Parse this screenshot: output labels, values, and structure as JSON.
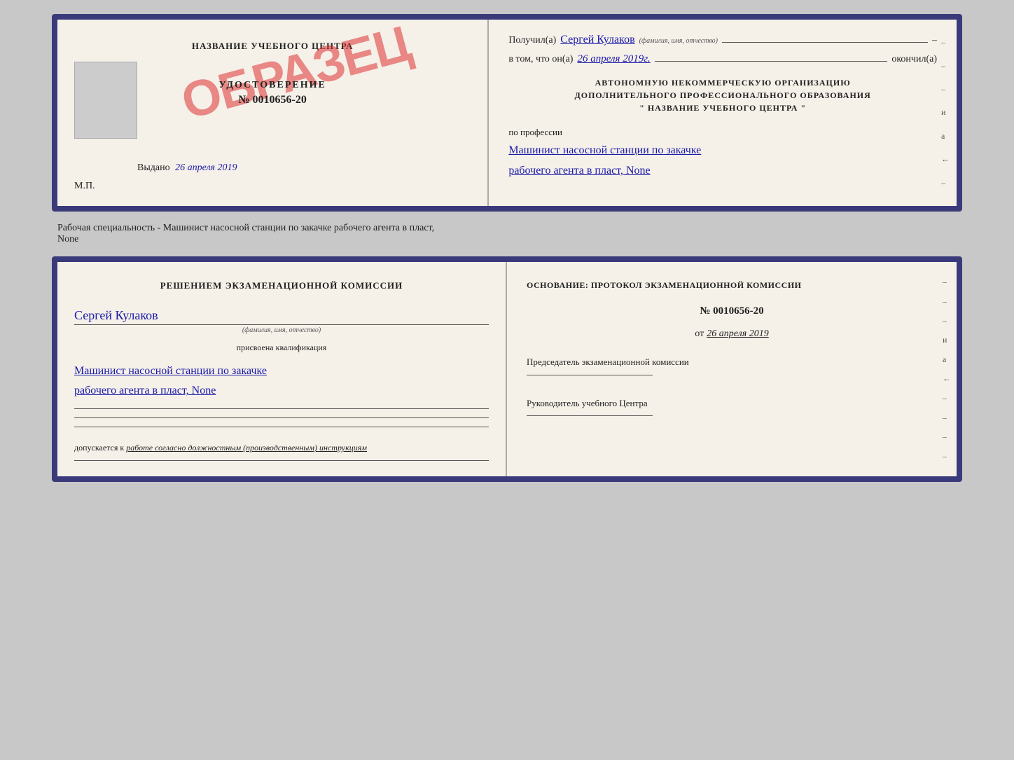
{
  "topDoc": {
    "left": {
      "training_center": "НАЗВАНИЕ УЧЕБНОГО ЦЕНТРА",
      "cert_label": "УДОСТОВЕРЕНИЕ",
      "cert_number": "№ 0010656-20",
      "stamp": "ОБРАЗЕЦ",
      "issued_label": "Выдано",
      "issued_date": "26 апреля 2019",
      "mp_label": "М.П."
    },
    "right": {
      "received_label": "Получил(а)",
      "received_name": "Сергей Кулаков",
      "received_hint": "(фамилия, имя, отчество)",
      "in_that_label": "в том, что он(а)",
      "in_that_date": "26 апреля 2019г.",
      "finished_label": "окончил(а)",
      "org_line1": "АВТОНОМНУЮ НЕКОММЕРЧЕСКУЮ ОРГАНИЗАЦИЮ",
      "org_line2": "ДОПОЛНИТЕЛЬНОГО ПРОФЕССИОНАЛЬНОГО ОБРАЗОВАНИЯ",
      "org_line3": "\"  НАЗВАНИЕ УЧЕБНОГО ЦЕНТРА  \"",
      "profession_label": "по профессии",
      "profession_line1": "Машинист насосной станции по закачке",
      "profession_line2": "рабочего агента в пласт, None"
    }
  },
  "middleText": {
    "line1": "Рабочая специальность - Машинист насосной станции по закачке рабочего агента в пласт,",
    "line2": "None"
  },
  "bottomDoc": {
    "left": {
      "decision_text": "Решением экзаменационной комиссии",
      "name": "Сергей Кулаков",
      "name_hint": "(фамилия, имя, отчество)",
      "assigned_label": "присвоена квалификация",
      "qualification_line1": "Машинист насосной станции по закачке",
      "qualification_line2": "рабочего агента в пласт, None",
      "allowed_label": "допускается к",
      "allowed_text": "работе согласно должностным (производственным) инструкциям"
    },
    "right": {
      "osnov_label": "Основание: протокол экзаменационной комиссии",
      "protocol_number": "№ 0010656-20",
      "protocol_date_prefix": "от",
      "protocol_date": "26 апреля 2019",
      "chairman_label": "Председатель экзаменационной комиссии",
      "head_label": "Руководитель учебного Центра"
    }
  },
  "dashes": [
    "-",
    "-",
    "-",
    "и",
    "а",
    "←",
    "-",
    "-",
    "-",
    "-"
  ]
}
